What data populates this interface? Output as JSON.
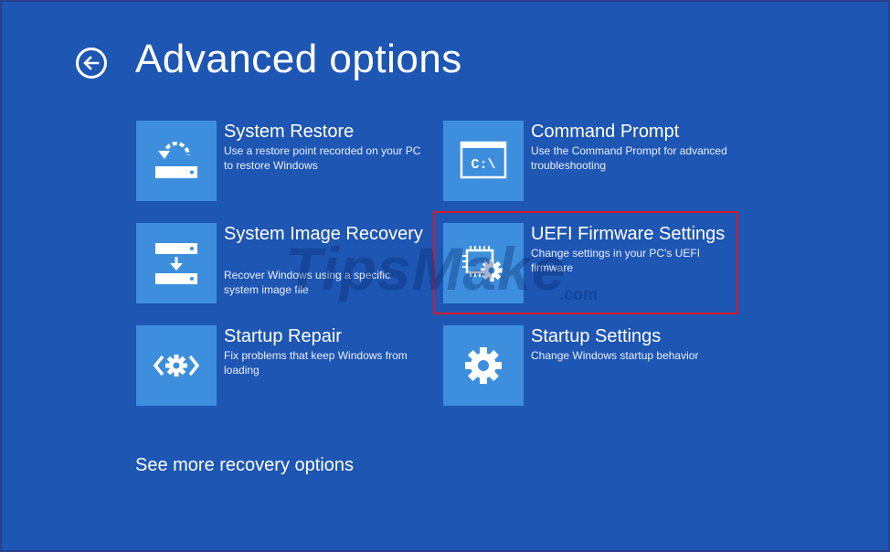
{
  "page": {
    "title": "Advanced options",
    "see_more": "See more recovery options"
  },
  "options": [
    {
      "title": "System Restore",
      "description": "Use a restore point recorded on your PC to restore Windows",
      "icon": "system-restore-icon"
    },
    {
      "title": "Command Prompt",
      "description": "Use the Command Prompt for advanced troubleshooting",
      "icon": "command-prompt-icon"
    },
    {
      "title": "System Image Recovery",
      "description": "Recover Windows using a specific system image file",
      "icon": "system-image-icon"
    },
    {
      "title": "UEFI Firmware Settings",
      "description": "Change settings in your PC's UEFI firmware",
      "icon": "firmware-chip-gear-icon"
    },
    {
      "title": "Startup Repair",
      "description": "Fix problems that keep Windows from loading",
      "icon": "startup-repair-icon"
    },
    {
      "title": "Startup Settings",
      "description": "Change Windows startup behavior",
      "icon": "gear-icon"
    }
  ],
  "command_prompt_glyph": "C:\\",
  "watermark": {
    "text": "TipsMake",
    "suffix": ".com"
  },
  "colors": {
    "background": "#1e56b3",
    "tile": "#3d8fdd",
    "highlight": "#d3182a"
  }
}
